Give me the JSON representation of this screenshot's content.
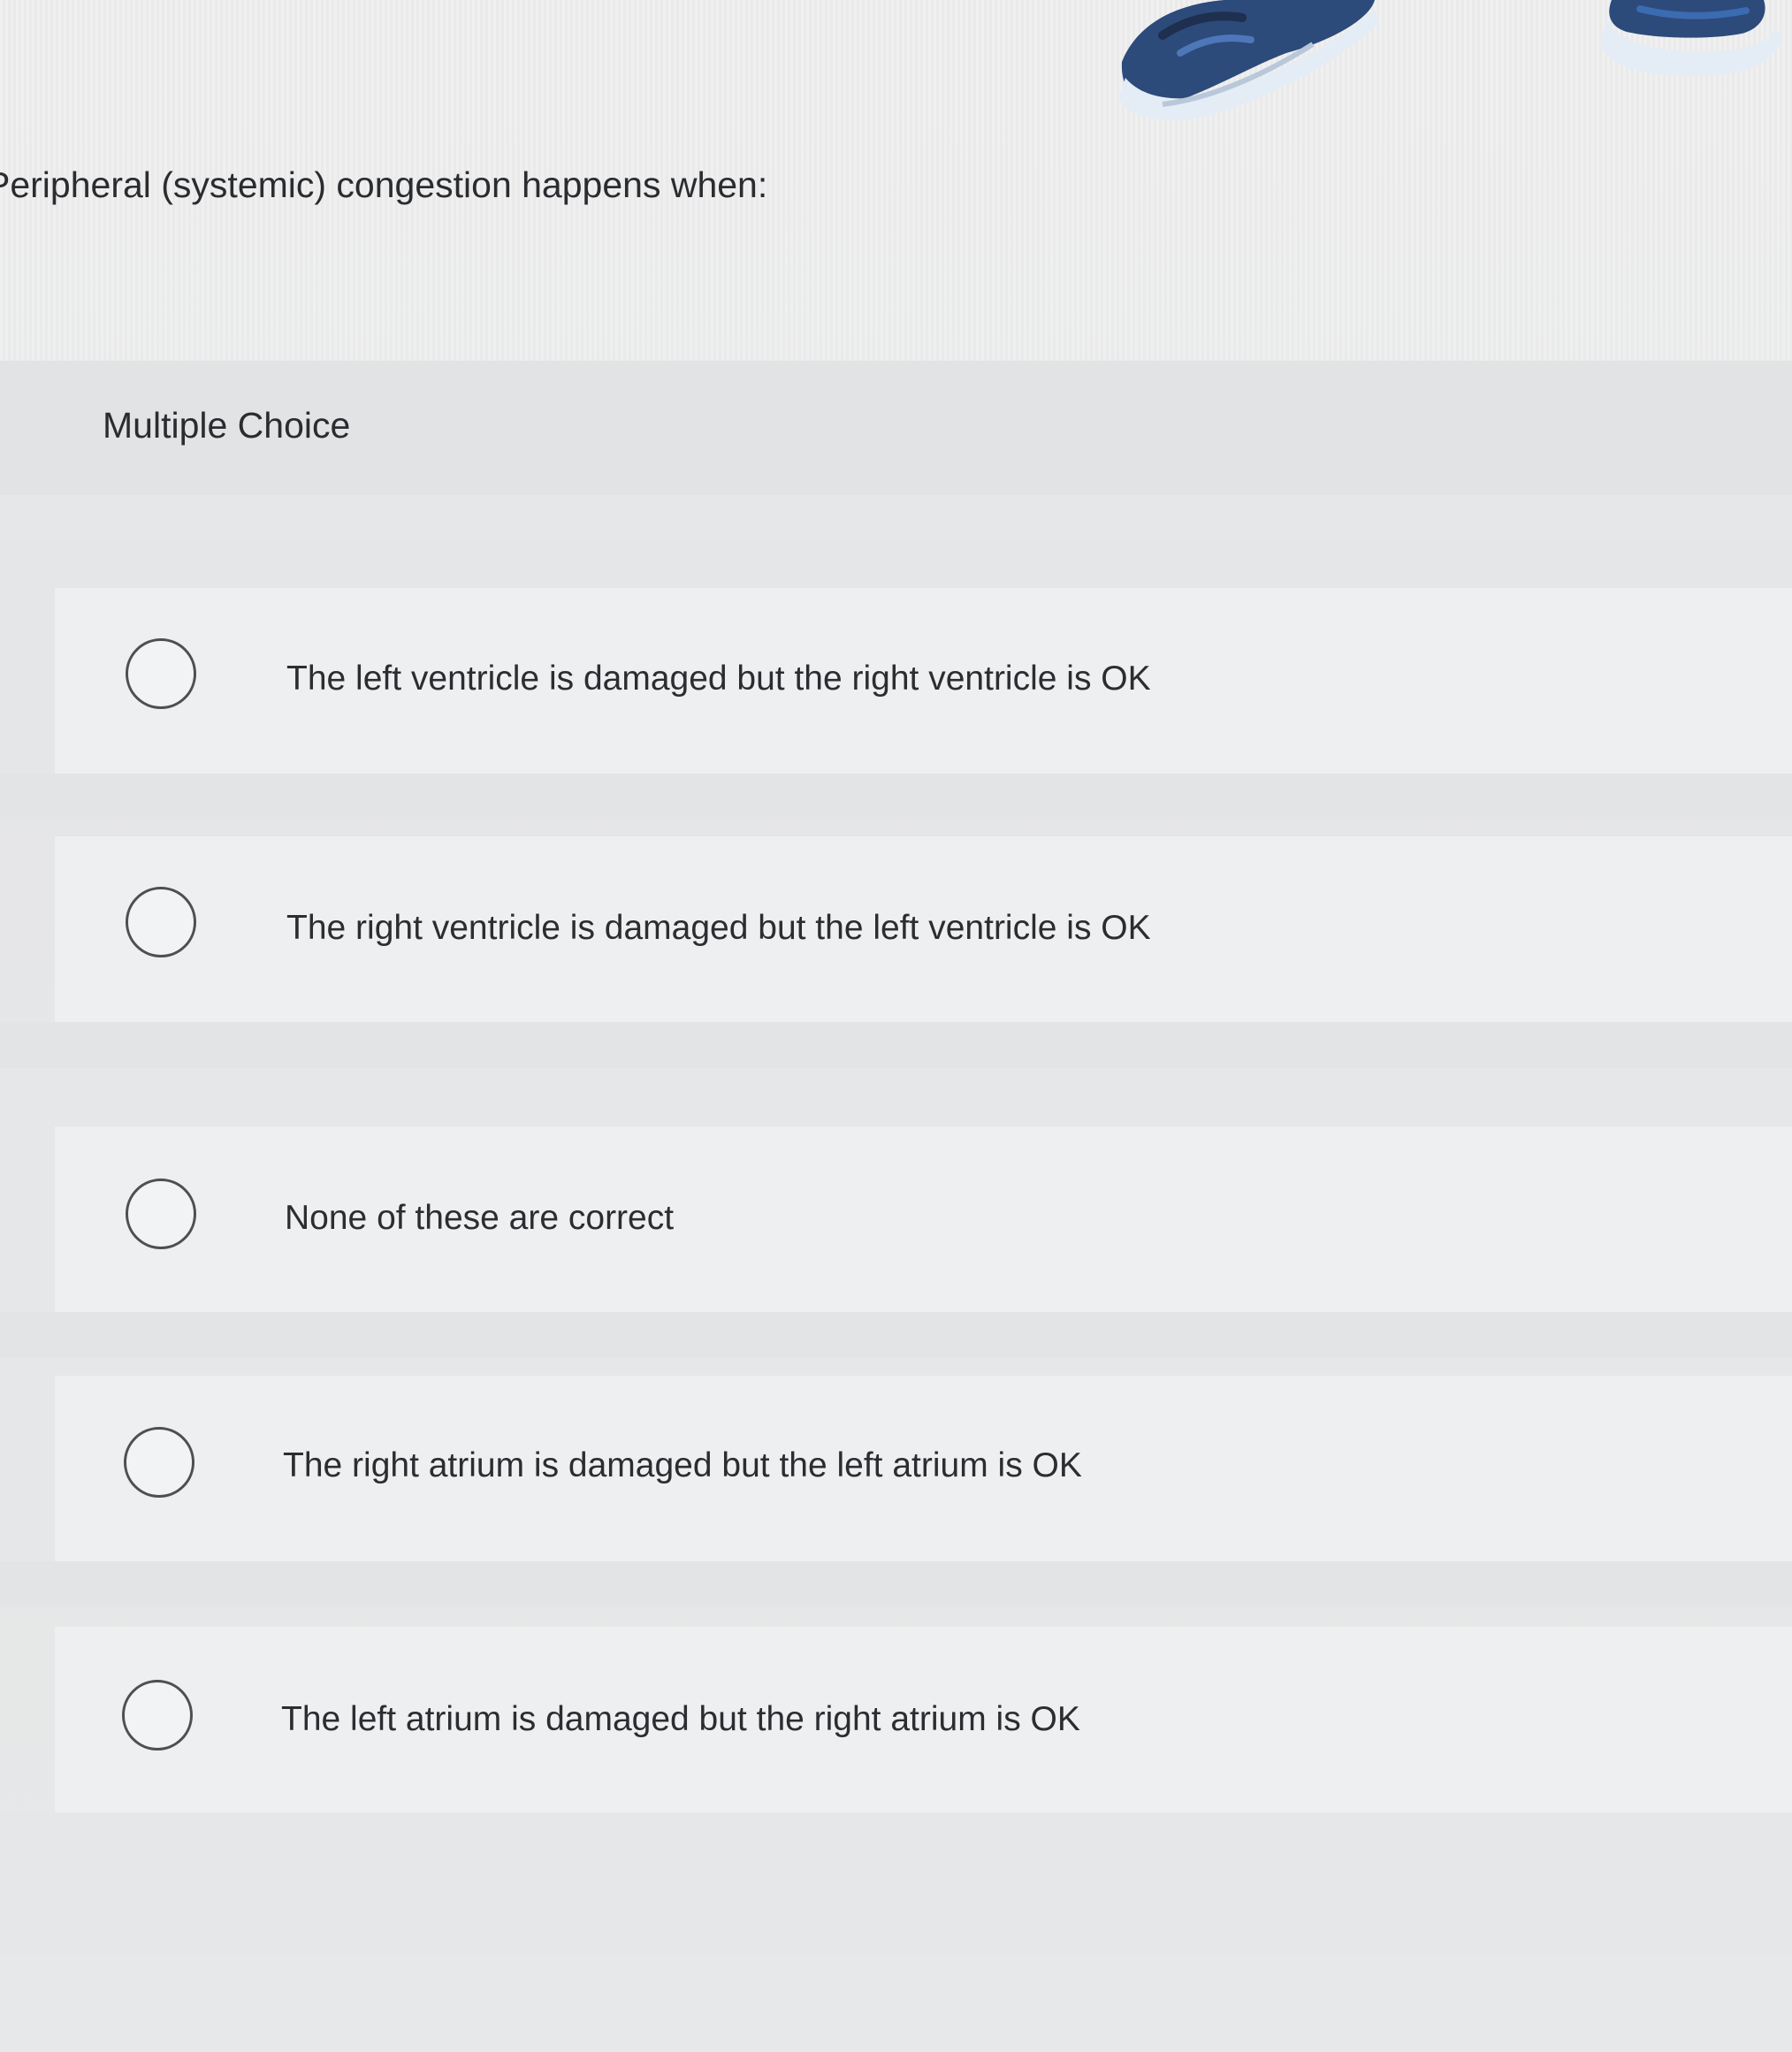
{
  "question": {
    "text": "Peripheral (systemic) congestion happens when:"
  },
  "section": {
    "label": "Multiple Choice"
  },
  "choices": [
    {
      "label": "The left ventricle is damaged but the right ventricle is OK"
    },
    {
      "label": "The right ventricle is damaged but the left ventricle is OK"
    },
    {
      "label": "None of these are correct"
    },
    {
      "label": "The right atrium is damaged but the left atrium is OK"
    },
    {
      "label": "The left atrium is damaged but the right atrium is OK"
    }
  ],
  "colors": {
    "background": "#e9eaeb",
    "text": "#2b2d30",
    "radio_border": "#4d4f52",
    "illustration_navy": "#2c4a7a",
    "illustration_blue": "#3b6bb0"
  },
  "icons": {
    "radio": "radio-unselected-icon",
    "illustration": "sneakers-illustration"
  }
}
